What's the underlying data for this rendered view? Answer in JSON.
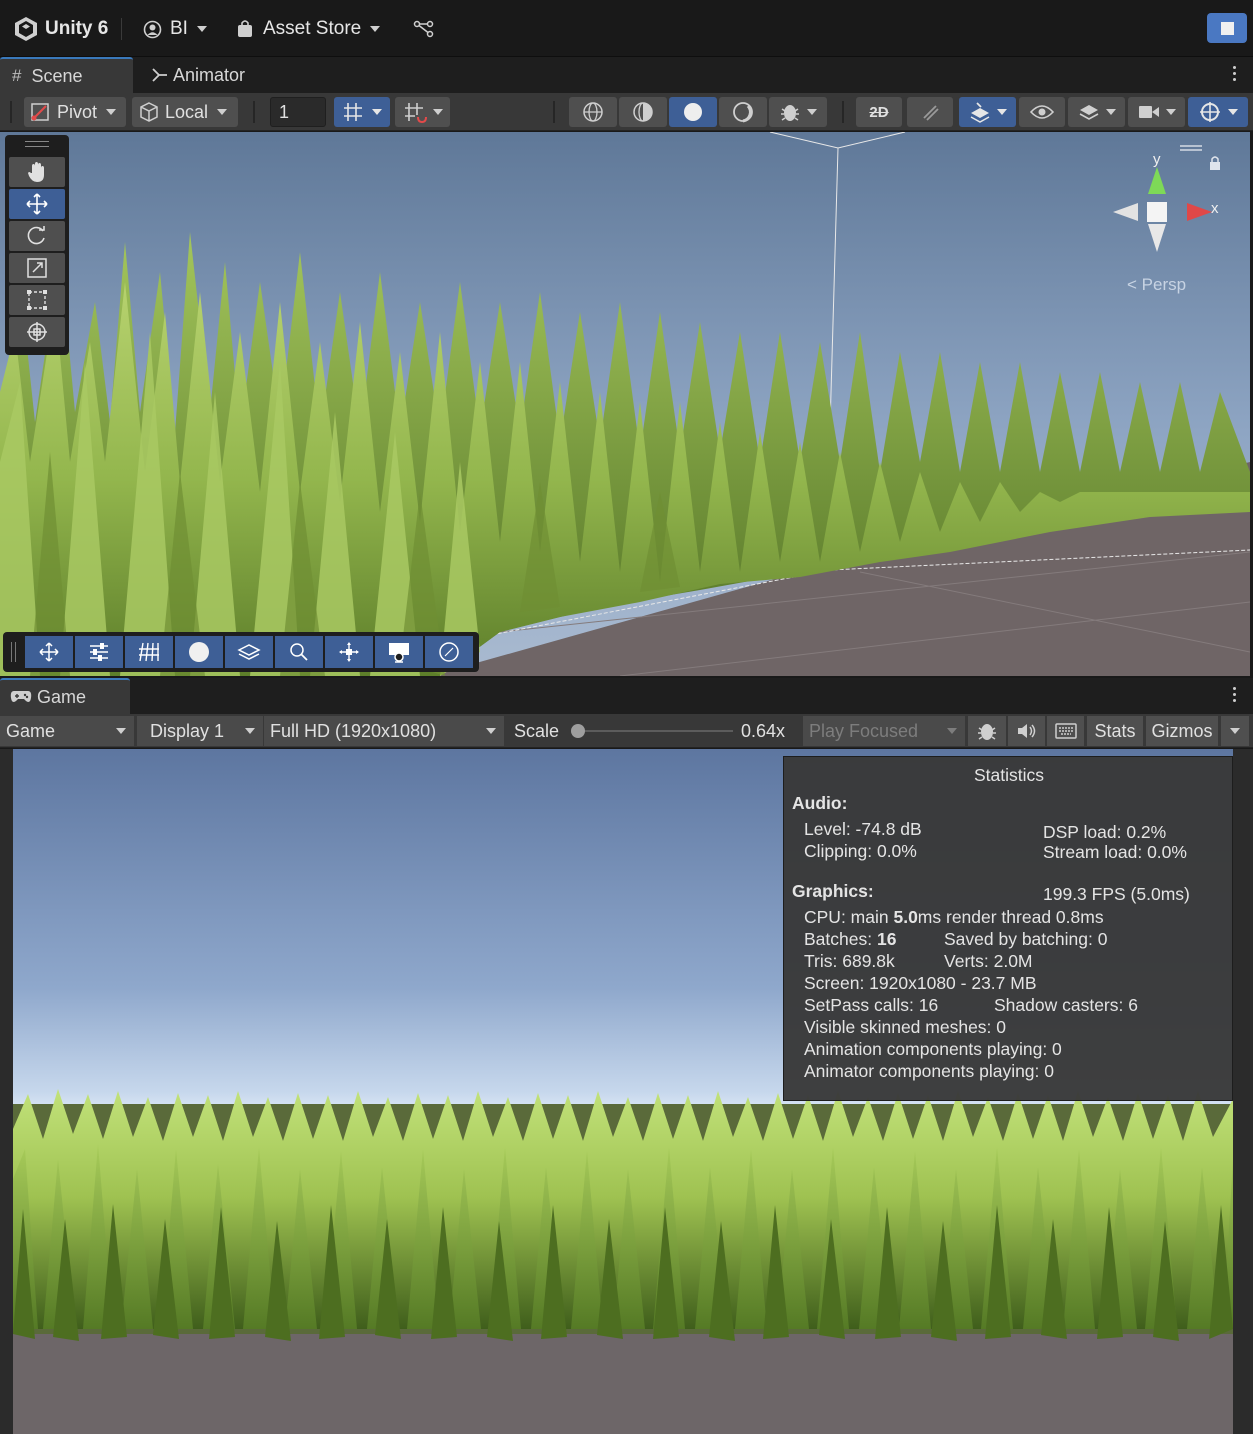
{
  "app_bar": {
    "title": "Unity 6",
    "account": "BI",
    "asset_store": "Asset Store"
  },
  "scene_tabs": [
    {
      "label": "Scene",
      "icon": "grid-icon"
    },
    {
      "label": "Animator",
      "icon": "animator-icon"
    }
  ],
  "scene_toolbar": {
    "pivot": "Pivot",
    "local": "Local",
    "snap_value": "1"
  },
  "scene_view": {
    "camera_mode": "Persp",
    "axis_y": "y",
    "axis_x": "x",
    "active_tool": "move"
  },
  "game_tab": {
    "label": "Game",
    "icon": "gamepad-icon"
  },
  "game_toolbar": {
    "view_mode": "Game",
    "display": "Display 1",
    "resolution": "Full HD (1920x1080)",
    "scale_label": "Scale",
    "scale_value": "0.64x",
    "scale_fraction": 0,
    "play_mode": "Play Focused",
    "stats_label": "Stats",
    "gizmos_label": "Gizmos"
  },
  "statistics": {
    "title": "Statistics",
    "audio_heading": "Audio:",
    "level": "Level: -74.8 dB",
    "clipping": "Clipping: 0.0%",
    "dsp_load": "DSP load: 0.2%",
    "stream_load": "Stream load: 0.0%",
    "graphics_heading": "Graphics:",
    "fps": "199.3 FPS (5.0ms)",
    "cpu_prefix": "CPU: main ",
    "cpu_main": "5.0",
    "cpu_suffix": "ms  render thread 0.8ms",
    "batches_prefix": "Batches: ",
    "batches": "16",
    "saved_by_batching": "Saved by batching: 0",
    "tris": "Tris: 689.8k",
    "verts": "Verts: 2.0M",
    "screen": "Screen: 1920x1080 - 23.7 MB",
    "setpass": "SetPass calls: 16",
    "shadow_casters": "Shadow casters: 6",
    "visible_skinned": "Visible skinned meshes: 0",
    "animation_components": "Animation components playing: 0",
    "animator_components": "Animator components playing: 0"
  },
  "colors": {
    "accent": "#3e5f96",
    "tab_highlight": "#3a79bb",
    "grass_light": "#b4d86a",
    "grass_dark": "#5d7e2a",
    "sky": "#6b83a6"
  }
}
